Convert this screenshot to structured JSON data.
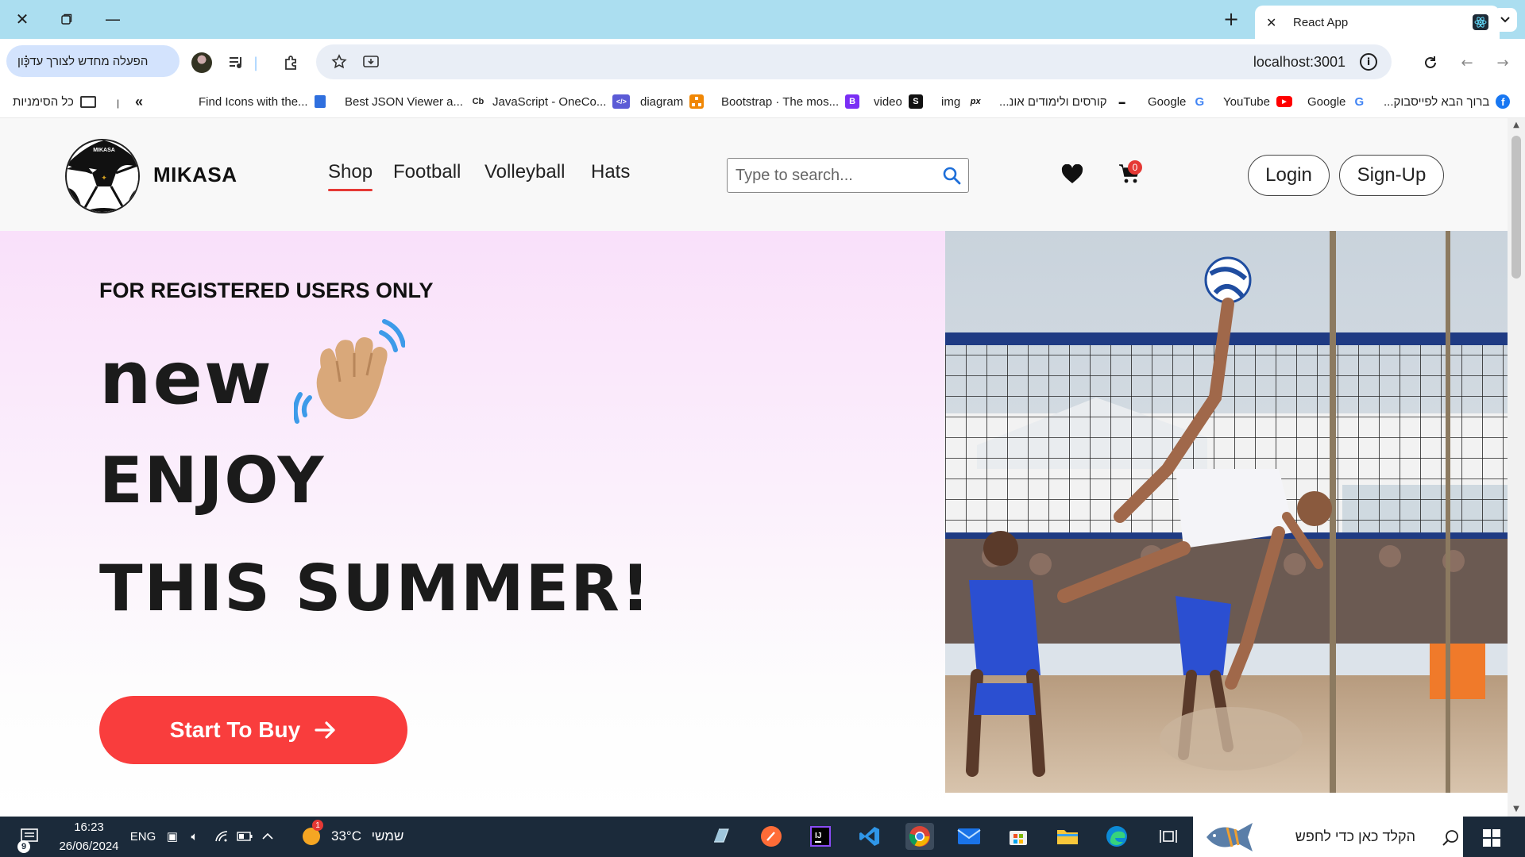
{
  "browser": {
    "tab_title": "React App",
    "new_tab_label": "+",
    "update_label": "הפעלה מחדש לצורך עדכון",
    "url": "localhost:3001",
    "colors": {
      "titlebar": "#abdef0",
      "omnibox": "#e9eef6",
      "update_pill": "#d3e3fd"
    }
  },
  "bookmarks": [
    {
      "label": "כל הסימניות",
      "icon": "folder-icon"
    },
    {
      "label": "Find Icons with the...",
      "icon": "flag-icon"
    },
    {
      "label": "Best JSON Viewer a...",
      "icon": "cb-icon",
      "icon_text": "Cb"
    },
    {
      "label": "JavaScript - OneCo...",
      "icon": "code-icon",
      "icon_text": "</>"
    },
    {
      "label": "diagram",
      "icon": "diagram-icon"
    },
    {
      "label": "Bootstrap · The mos...",
      "icon": "bootstrap-icon",
      "icon_text": "B"
    },
    {
      "label": "video",
      "icon": "video-icon",
      "icon_text": "S"
    },
    {
      "label": "img",
      "icon": "px-icon",
      "icon_text": "px"
    },
    {
      "label": "...קורסים ולימודים אונ",
      "icon": "courses-icon"
    },
    {
      "label": "Google",
      "icon": "google-icon",
      "icon_text": "G"
    },
    {
      "label": "YouTube",
      "icon": "youtube-icon"
    },
    {
      "label": "Google",
      "icon": "google-icon",
      "icon_text": "G"
    },
    {
      "label": "...ברוך הבא לפייסבוק",
      "icon": "facebook-icon",
      "icon_text": "f"
    }
  ],
  "site": {
    "brand": "MIKASA",
    "nav": [
      "Shop",
      "Football",
      "Volleyball",
      "Hats"
    ],
    "active_nav": "Shop",
    "search_placeholder": "Type to search...",
    "cart_count": "0",
    "login_label": "Login",
    "signup_label": "Sign-Up",
    "accent": "#e53935"
  },
  "hero": {
    "kicker": "FOR REGISTERED USERS ONLY",
    "line1": "new",
    "line2": "ENJOY",
    "line3": "THIS SUMMER!",
    "cta_label": "Start To Buy",
    "cta_color": "#f93d3d",
    "wave_icon": "waving-hand-icon"
  },
  "taskbar": {
    "notification_count": "9",
    "time": "16:23",
    "date": "26/06/2024",
    "language": "ENG",
    "weather_temp": "33°C",
    "weather_label": "שמשי",
    "weather_badge": "1",
    "search_placeholder": "הקלד כאן כדי לחפש"
  }
}
